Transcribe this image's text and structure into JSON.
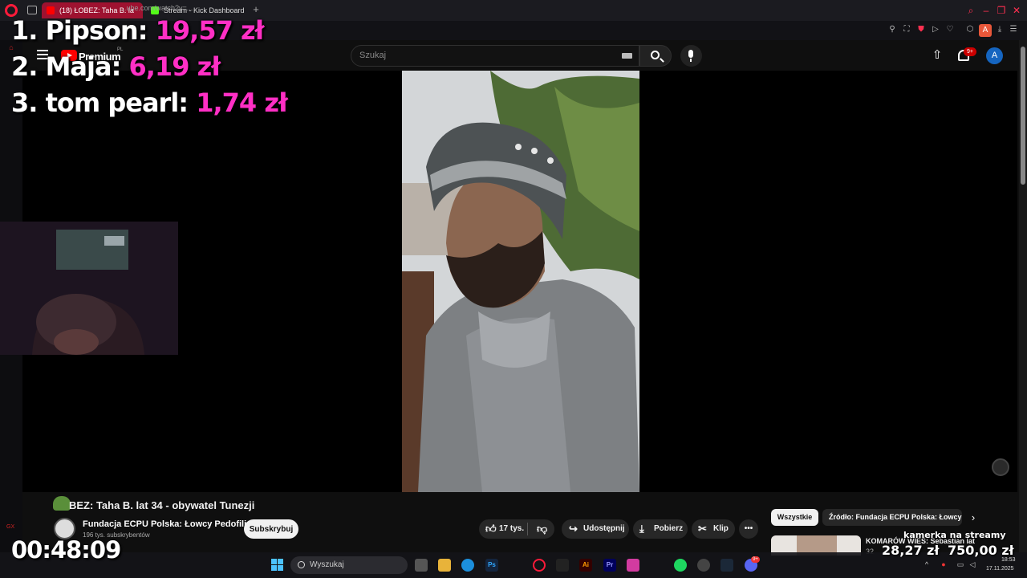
{
  "browser": {
    "tabs": [
      {
        "label": "(18) ŁOBEZ: Taha B. la",
        "active": true
      },
      {
        "label": "Stream - Kick Dashboard",
        "active": false
      }
    ],
    "url": "...ube.com/watch?v=..."
  },
  "youtube": {
    "logo_text": "Premium",
    "region": "PL",
    "search_placeholder": "Szukaj",
    "notifications_badge": "9+",
    "avatar_letter": "A"
  },
  "overlay": {
    "leaderboard": [
      {
        "rank": "1.",
        "name": "Pipson:",
        "amount": "19,57 zł"
      },
      {
        "rank": "2.",
        "name": "Maja:",
        "amount": "6,19 zł"
      },
      {
        "rank": "3.",
        "name": "tom pearl:",
        "amount": "1,74 zł"
      }
    ],
    "timer": "00:48:09",
    "goal": {
      "label": "kamerka na streamy",
      "current": "28,27 zł",
      "target": "750,00 zł"
    },
    "gx": "GX"
  },
  "video": {
    "title": "BEZ: Taha B. lat 34 - obywatel Tunezji",
    "channel": {
      "name": "Fundacja ECPU Polska: Łowcy Pedofili",
      "subs": "196 tys. subskrybentów"
    },
    "subscribe_label": "Subskrybuj",
    "actions": {
      "likes": "17 tys.",
      "share": "Udostępnij",
      "download": "Pobierz",
      "clip": "Klip"
    }
  },
  "sidebar_recs": {
    "chips": [
      "Wszystkie",
      "Źródło: Fundacja ECPU Polska: Łowcy"
    ],
    "items": [
      {
        "title": "KOMARÓW WIEŚ: Sebastian lat",
        "sub": "32"
      }
    ]
  },
  "taskbar": {
    "search_placeholder": "Wyszukaj",
    "time": "18:53",
    "date": "17.11.2025",
    "discord_badge": "9+"
  },
  "colors": {
    "accent_opera": "#ff1b3a",
    "amount_pink": "#ff2fc5",
    "yt_red": "#ff0000"
  }
}
